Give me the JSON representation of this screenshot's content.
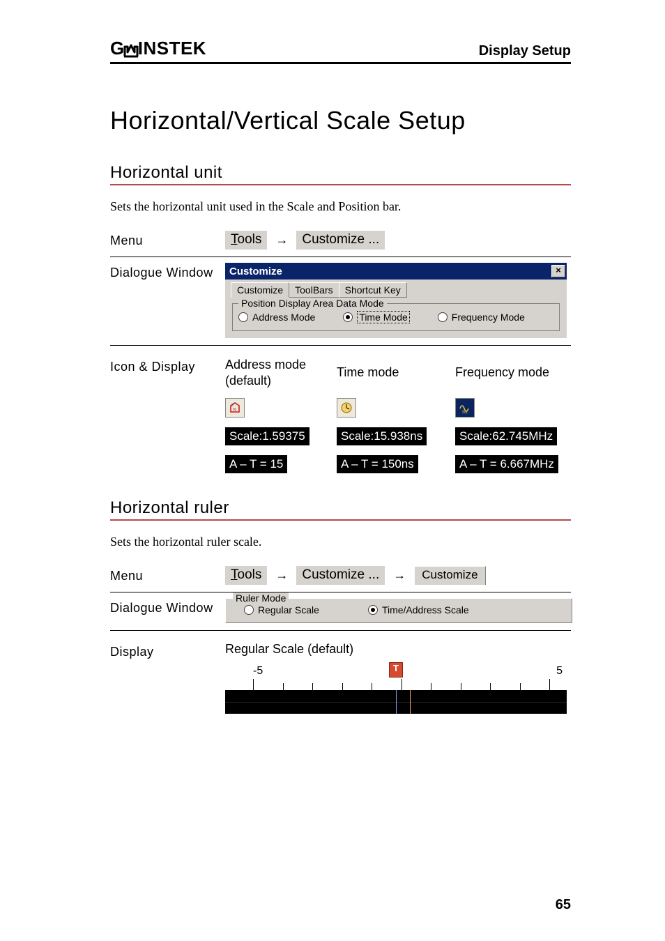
{
  "header": {
    "brand_g": "G",
    "brand_rest": "INSTEK",
    "section": "Display Setup"
  },
  "title": "Horizontal/Vertical Scale Setup",
  "h_unit": {
    "heading": "Horizontal unit",
    "intro": "Sets the horizontal unit used in the Scale and Position bar.",
    "menu_label": "Menu",
    "menu_tools_ul": "T",
    "menu_tools_rest": "ools",
    "menu_customize": "Customize ...",
    "dialogue_label": "Dialogue Window",
    "dlg_title": "Customize",
    "tabs": {
      "t1": "Customize",
      "t2": "ToolBars",
      "t3": "Shortcut Key"
    },
    "group_title": "Position Display Area Data Mode",
    "radios": {
      "address": "Address Mode",
      "time": "Time Mode",
      "freq": "Frequency Mode"
    },
    "icon_label": "Icon & Display",
    "cols": {
      "addr": "Address mode (default)",
      "time": "Time mode",
      "freq": "Frequency mode"
    },
    "scale": {
      "addr": "Scale:1.59375",
      "time": "Scale:15.938ns",
      "freq": "Scale:62.745MHz"
    },
    "at": {
      "addr": "A – T = 15",
      "time": "A – T = 150ns",
      "freq": "A – T = 6.667MHz"
    }
  },
  "h_ruler": {
    "heading": "Horizontal ruler",
    "intro": "Sets the horizontal ruler scale.",
    "menu_label": "Menu",
    "menu_tools_ul": "T",
    "menu_tools_rest": "ools",
    "menu_customize": "Customize ...",
    "menu_tab": "Customize",
    "dialogue_label": "Dialogue Window",
    "group_title": "Ruler Mode",
    "radios": {
      "regular": "Regular Scale",
      "ta": "Time/Address Scale"
    },
    "display_label": "Display",
    "display_value": "Regular Scale (default)",
    "ruler_left": "-5",
    "ruler_right": "5",
    "t_marker": "T"
  },
  "page_number": "65"
}
